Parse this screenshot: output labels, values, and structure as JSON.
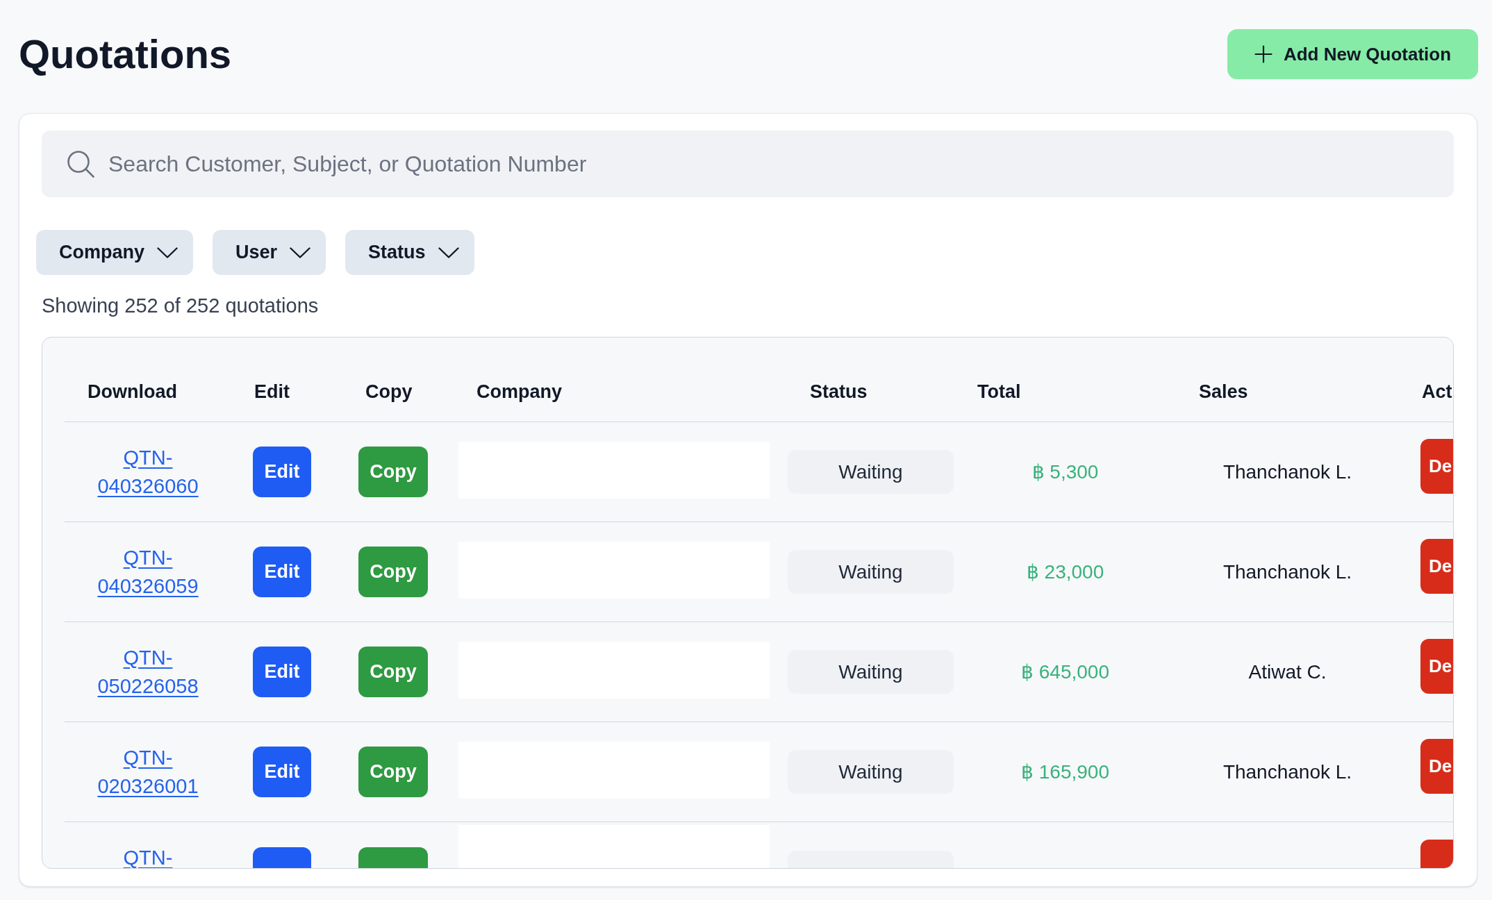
{
  "header": {
    "title": "Quotations",
    "add_button": "Add New Quotation"
  },
  "search": {
    "placeholder": "Search Customer, Subject, or Quotation Number"
  },
  "filters": [
    {
      "label": "Company"
    },
    {
      "label": "User"
    },
    {
      "label": "Status"
    }
  ],
  "result_count": "Showing 252 of 252 quotations",
  "table": {
    "columns": [
      "Download",
      "Edit",
      "Copy",
      "Company",
      "Status",
      "Total",
      "Sales",
      "Act"
    ],
    "rows": [
      {
        "quotation": [
          "QTN-",
          "040326060"
        ],
        "edit": "Edit",
        "copy": "Copy",
        "status": "Waiting",
        "total": "฿ 5,300",
        "sales": "Thanchanok L.",
        "action": "De"
      },
      {
        "quotation": [
          "QTN-",
          "040326059"
        ],
        "edit": "Edit",
        "copy": "Copy",
        "status": "Waiting",
        "total": "฿ 23,000",
        "sales": "Thanchanok L.",
        "action": "De"
      },
      {
        "quotation": [
          "QTN-",
          "050226058"
        ],
        "edit": "Edit",
        "copy": "Copy",
        "status": "Waiting",
        "total": "฿ 645,000",
        "sales": "Atiwat C.",
        "action": "De"
      },
      {
        "quotation": [
          "QTN-",
          "020326001"
        ],
        "edit": "Edit",
        "copy": "Copy",
        "status": "Waiting",
        "total": "฿ 165,900",
        "sales": "Thanchanok L.",
        "action": "De"
      },
      {
        "quotation": [
          "QTN-"
        ]
      }
    ]
  }
}
